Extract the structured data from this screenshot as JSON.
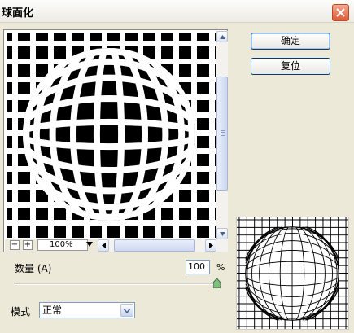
{
  "window": {
    "title": "球面化"
  },
  "buttons": {
    "ok": "确定",
    "reset": "复位"
  },
  "preview": {
    "zoom": "100%"
  },
  "amount": {
    "label": "数量 (A)",
    "value": "100",
    "unit": "%"
  },
  "mode": {
    "label": "模式",
    "value": "正常"
  },
  "icons": {
    "close": "close-icon",
    "zoom_out": "minus-icon",
    "zoom_in": "plus-icon",
    "scroll_up": "arrow-up-icon",
    "scroll_down": "arrow-down-icon",
    "scroll_left": "arrow-left-icon",
    "scroll_right": "arrow-right-icon",
    "dropdown": "chevron-down-icon"
  }
}
